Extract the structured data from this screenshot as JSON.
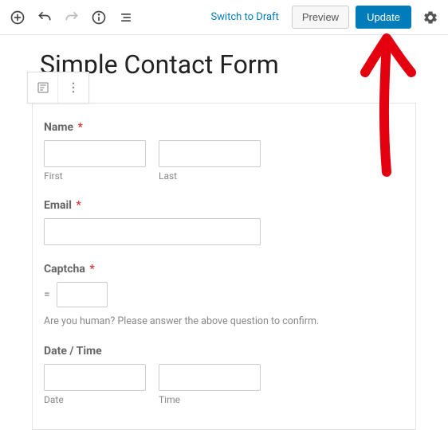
{
  "topbar": {
    "switch_draft": "Switch to Draft",
    "preview": "Preview",
    "update": "Update"
  },
  "page": {
    "title": "Simple Contact Form"
  },
  "form": {
    "name": {
      "label": "Name",
      "required_mark": "*",
      "first_sub": "First",
      "last_sub": "Last"
    },
    "email": {
      "label": "Email",
      "required_mark": "*"
    },
    "captcha": {
      "label": "Captcha",
      "required_mark": "*",
      "equals": "=",
      "hint": "Are you human? Please answer the above question to confirm."
    },
    "datetime": {
      "label": "Date / Time",
      "date_sub": "Date",
      "time_sub": "Time"
    }
  }
}
